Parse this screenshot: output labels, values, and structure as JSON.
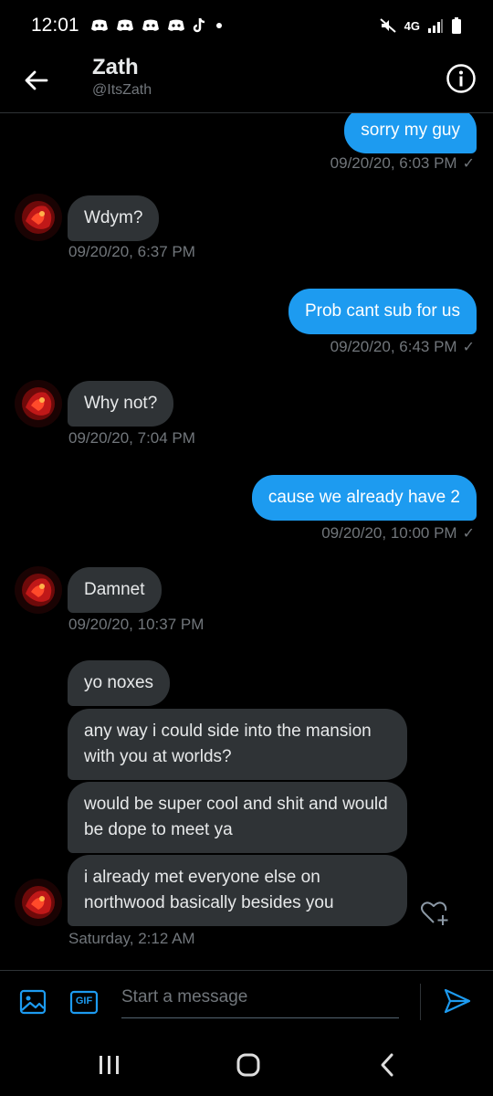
{
  "status_bar": {
    "time": "12:01",
    "left_icons": [
      "discord-icon",
      "discord-icon",
      "discord-icon",
      "discord-icon",
      "tiktok-icon",
      "dot-icon"
    ],
    "right_icons": [
      "mute-icon",
      "network-5g-icon",
      "signal-icon",
      "battery-icon"
    ],
    "network_label": "4G"
  },
  "header": {
    "name": "Zath",
    "handle": "@ItsZath"
  },
  "messages": [
    {
      "dir": "out",
      "text": "sorry my guy",
      "time": "09/20/20, 6:03 PM"
    },
    {
      "dir": "in",
      "text": "Wdym?",
      "time": "09/20/20, 6:37 PM"
    },
    {
      "dir": "out",
      "text": "Prob cant sub for us",
      "time": "09/20/20, 6:43 PM"
    },
    {
      "dir": "in",
      "text": "Why not?",
      "time": "09/20/20, 7:04 PM"
    },
    {
      "dir": "out",
      "text": "cause we already have 2",
      "time": "09/20/20, 10:00 PM"
    },
    {
      "dir": "in",
      "text": "Damnet",
      "time": "09/20/20, 10:37 PM"
    },
    {
      "dir": "in",
      "text": "yo noxes"
    },
    {
      "dir": "in",
      "text": "any way i could side into the mansion with you at worlds?"
    },
    {
      "dir": "in",
      "text": "would be super cool and shit and would be dope to meet ya"
    },
    {
      "dir": "in",
      "text": "i already met everyone else on northwood basically besides you",
      "time": "Saturday, 2:12 AM"
    }
  ],
  "composer": {
    "placeholder": "Start a message",
    "gif_label": "GIF"
  },
  "colors": {
    "accent": "#1d9bf0",
    "incoming_bubble": "#2f3336",
    "muted_text": "#71767b",
    "background": "#000000"
  }
}
